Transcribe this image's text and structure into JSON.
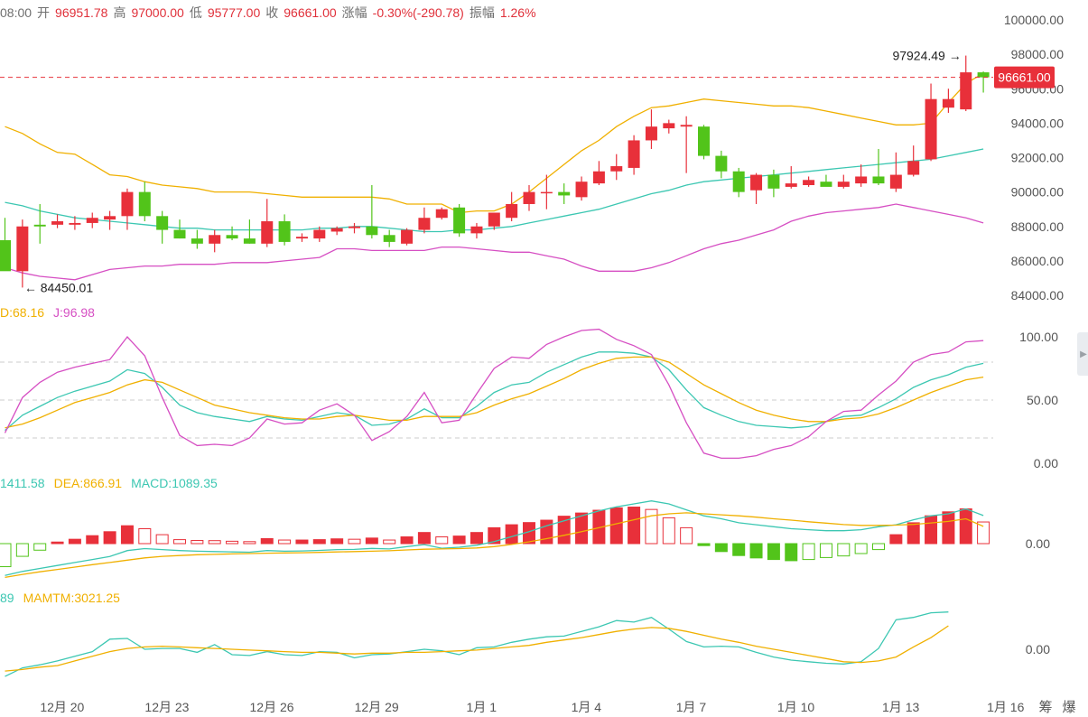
{
  "header": {
    "time": "08:00",
    "open_label": "开",
    "open": "96951.78",
    "high_label": "高",
    "high": "97000.00",
    "low_label": "低",
    "low": "95777.00",
    "close_label": "收",
    "close": "96661.00",
    "change_label": "涨幅",
    "change": "-0.30%(-290.78)",
    "amp_label": "振幅",
    "amp": "1.26%"
  },
  "colors": {
    "up": "#e8303a",
    "down": "#52c41a",
    "ma_yellow": "#f0b000",
    "ma_teal": "#3cc7b2",
    "ma_magenta": "#d64fc3",
    "price_tag": "#e8303a",
    "grid_dash": "#cccccc"
  },
  "annotations": {
    "max_label": "97924.49",
    "min_label": "84450.01",
    "current_price": "96661.00"
  },
  "kdj_labels": {
    "d": "D:68.16",
    "j": "J:96.98"
  },
  "macd_labels": {
    "dif": "1411.58",
    "dea": "DEA:866.91",
    "macd": "MACD:1089.35"
  },
  "mtm_labels": {
    "mtm": "89",
    "mamtm": "MAMTM:3021.25"
  },
  "right_tools": {
    "a": "筹",
    "b": "爆"
  },
  "chart_data": [
    {
      "type": "candlestick",
      "y_ticks": [
        "100000.00",
        "98000.00",
        "96000.00",
        "94000.00",
        "92000.00",
        "90000.00",
        "88000.00",
        "86000.00",
        "84000.00"
      ],
      "ylim": [
        84000,
        100000
      ],
      "x_ticks": [
        "12月 20",
        "12月 23",
        "12月 26",
        "12月 29",
        "1月 1",
        "1月 4",
        "1月 7",
        "1月 10",
        "1月 13",
        "1月 16"
      ],
      "x_tick_index": [
        1,
        7,
        13,
        19,
        25,
        31,
        37,
        43,
        49,
        55
      ],
      "candles": [
        {
          "o": 87200,
          "h": 88500,
          "l": 85500,
          "c": 85400
        },
        {
          "o": 85400,
          "h": 88400,
          "l": 84450.01,
          "c": 88000
        },
        {
          "o": 88100,
          "h": 89300,
          "l": 87000,
          "c": 88000
        },
        {
          "o": 88100,
          "h": 88700,
          "l": 87900,
          "c": 88300
        },
        {
          "o": 88100,
          "h": 88600,
          "l": 87800,
          "c": 88200
        },
        {
          "o": 88200,
          "h": 88800,
          "l": 87900,
          "c": 88500
        },
        {
          "o": 88400,
          "h": 88900,
          "l": 87800,
          "c": 88600
        },
        {
          "o": 88600,
          "h": 90200,
          "l": 87800,
          "c": 90000
        },
        {
          "o": 90000,
          "h": 90600,
          "l": 88300,
          "c": 88600
        },
        {
          "o": 88600,
          "h": 88900,
          "l": 87000,
          "c": 87800
        },
        {
          "o": 87800,
          "h": 88400,
          "l": 87300,
          "c": 87300
        },
        {
          "o": 87300,
          "h": 87800,
          "l": 86700,
          "c": 87000
        },
        {
          "o": 87000,
          "h": 87800,
          "l": 86500,
          "c": 87500
        },
        {
          "o": 87500,
          "h": 88000,
          "l": 87200,
          "c": 87300
        },
        {
          "o": 87300,
          "h": 88400,
          "l": 87000,
          "c": 87000
        },
        {
          "o": 87000,
          "h": 89600,
          "l": 86800,
          "c": 88300
        },
        {
          "o": 88300,
          "h": 88700,
          "l": 86900,
          "c": 87100
        },
        {
          "o": 87300,
          "h": 87600,
          "l": 87100,
          "c": 87400
        },
        {
          "o": 87300,
          "h": 88000,
          "l": 87100,
          "c": 87800
        },
        {
          "o": 87700,
          "h": 88000,
          "l": 87500,
          "c": 87900
        },
        {
          "o": 87900,
          "h": 88200,
          "l": 87600,
          "c": 88000
        },
        {
          "o": 88000,
          "h": 90400,
          "l": 87300,
          "c": 87500
        },
        {
          "o": 87500,
          "h": 87800,
          "l": 86800,
          "c": 87100
        },
        {
          "o": 87000,
          "h": 87900,
          "l": 86900,
          "c": 87800
        },
        {
          "o": 87800,
          "h": 89100,
          "l": 87600,
          "c": 88500
        },
        {
          "o": 88500,
          "h": 89100,
          "l": 88400,
          "c": 89000
        },
        {
          "o": 89100,
          "h": 89300,
          "l": 87400,
          "c": 87600
        },
        {
          "o": 87600,
          "h": 88200,
          "l": 87300,
          "c": 88000
        },
        {
          "o": 88000,
          "h": 88800,
          "l": 87800,
          "c": 88800
        },
        {
          "o": 88500,
          "h": 90000,
          "l": 88300,
          "c": 89300
        },
        {
          "o": 89300,
          "h": 90400,
          "l": 88900,
          "c": 90000
        },
        {
          "o": 90000,
          "h": 91000,
          "l": 89000,
          "c": 90000
        },
        {
          "o": 90000,
          "h": 90500,
          "l": 89300,
          "c": 89800
        },
        {
          "o": 89700,
          "h": 90900,
          "l": 89500,
          "c": 90600
        },
        {
          "o": 90500,
          "h": 91800,
          "l": 90400,
          "c": 91200
        },
        {
          "o": 91200,
          "h": 92200,
          "l": 90700,
          "c": 91500
        },
        {
          "o": 91400,
          "h": 93300,
          "l": 91000,
          "c": 93000
        },
        {
          "o": 93000,
          "h": 94800,
          "l": 92500,
          "c": 93800
        },
        {
          "o": 93700,
          "h": 94200,
          "l": 93400,
          "c": 94000
        },
        {
          "o": 93800,
          "h": 94400,
          "l": 91100,
          "c": 93900
        },
        {
          "o": 93800,
          "h": 93900,
          "l": 91900,
          "c": 92100
        },
        {
          "o": 92100,
          "h": 92400,
          "l": 90800,
          "c": 91200
        },
        {
          "o": 91200,
          "h": 91400,
          "l": 89700,
          "c": 90000
        },
        {
          "o": 90100,
          "h": 91100,
          "l": 89300,
          "c": 91000
        },
        {
          "o": 91000,
          "h": 91300,
          "l": 89700,
          "c": 90200
        },
        {
          "o": 90300,
          "h": 91500,
          "l": 90200,
          "c": 90500
        },
        {
          "o": 90400,
          "h": 90900,
          "l": 90300,
          "c": 90700
        },
        {
          "o": 90600,
          "h": 91000,
          "l": 90400,
          "c": 90300
        },
        {
          "o": 90300,
          "h": 91000,
          "l": 90200,
          "c": 90600
        },
        {
          "o": 90500,
          "h": 91600,
          "l": 90300,
          "c": 90900
        },
        {
          "o": 90900,
          "h": 92500,
          "l": 90400,
          "c": 90500
        },
        {
          "o": 90200,
          "h": 92300,
          "l": 90000,
          "c": 91000
        },
        {
          "o": 91000,
          "h": 92700,
          "l": 90900,
          "c": 91800
        },
        {
          "o": 91900,
          "h": 96300,
          "l": 91800,
          "c": 95400
        },
        {
          "o": 94900,
          "h": 96000,
          "l": 94600,
          "c": 95400
        },
        {
          "o": 94800,
          "h": 97924.49,
          "l": 94700,
          "c": 96951.78
        },
        {
          "o": 96951.78,
          "h": 97000,
          "l": 95777,
          "c": 96661
        }
      ],
      "boll": {
        "upper": [
          93800,
          93400,
          92800,
          92300,
          92200,
          91600,
          91000,
          90900,
          90600,
          90400,
          90300,
          90200,
          90000,
          90000,
          90000,
          89900,
          89800,
          89700,
          89700,
          89700,
          89700,
          89700,
          89600,
          89300,
          89300,
          89300,
          88800,
          88900,
          88900,
          89300,
          90000,
          90800,
          91600,
          92400,
          93000,
          93800,
          94400,
          94900,
          95000,
          95200,
          95400,
          95300,
          95200,
          95100,
          95000,
          95000,
          94900,
          94700,
          94500,
          94300,
          94100,
          93900,
          93900,
          94000,
          95200,
          96300,
          96900
        ],
        "middle": [
          89400,
          89200,
          88900,
          88700,
          88500,
          88400,
          88300,
          88200,
          88100,
          88000,
          87900,
          87900,
          87800,
          87800,
          87800,
          87800,
          87800,
          87800,
          87900,
          87900,
          88000,
          88000,
          87900,
          87800,
          87700,
          87700,
          87800,
          87800,
          87900,
          88000,
          88200,
          88400,
          88600,
          88800,
          89000,
          89300,
          89600,
          89900,
          90100,
          90400,
          90600,
          90700,
          90800,
          90900,
          91000,
          91100,
          91200,
          91300,
          91400,
          91500,
          91600,
          91700,
          91800,
          91900,
          92100,
          92300,
          92500
        ],
        "lower": [
          85600,
          85300,
          85100,
          85000,
          84900,
          85200,
          85500,
          85600,
          85700,
          85700,
          85800,
          85800,
          85800,
          85900,
          85900,
          85900,
          86000,
          86100,
          86200,
          86700,
          86700,
          86600,
          86600,
          86600,
          86600,
          86800,
          86800,
          86700,
          86600,
          86500,
          86500,
          86300,
          86100,
          85700,
          85400,
          85400,
          85400,
          85600,
          85900,
          86300,
          86700,
          87000,
          87200,
          87500,
          87800,
          88300,
          88600,
          88800,
          88900,
          89000,
          89100,
          89300,
          89100,
          88900,
          88700,
          88500,
          88200
        ]
      }
    },
    {
      "type": "line",
      "name_hint": "KDJ",
      "y_ticks": [
        "100.00",
        "50.00",
        "0.00"
      ],
      "ylim": [
        0,
        100
      ],
      "dashed_levels": [
        80,
        50,
        20
      ],
      "series": [
        {
          "name": "K",
          "values": [
            26,
            38,
            45,
            52,
            57,
            61,
            65,
            74,
            71,
            60,
            46,
            40,
            37,
            35,
            33,
            37,
            35,
            34,
            37,
            40,
            38,
            30,
            31,
            35,
            43,
            36,
            36,
            45,
            56,
            62,
            64,
            72,
            78,
            84,
            88,
            88,
            87,
            84,
            74,
            58,
            44,
            38,
            33,
            30,
            29,
            28,
            29,
            33,
            37,
            38,
            44,
            51,
            60,
            66,
            70,
            76,
            79
          ]
        },
        {
          "name": "D",
          "values": [
            28,
            31,
            36,
            42,
            48,
            52,
            56,
            62,
            66,
            64,
            58,
            52,
            46,
            43,
            40,
            38,
            36,
            35,
            35,
            37,
            38,
            36,
            34,
            34,
            37,
            37,
            37,
            40,
            46,
            51,
            55,
            61,
            67,
            74,
            79,
            83,
            84,
            84,
            80,
            71,
            62,
            55,
            48,
            42,
            38,
            35,
            33,
            33,
            35,
            36,
            39,
            44,
            50,
            56,
            61,
            66,
            68.16
          ]
        },
        {
          "name": "J",
          "values": [
            24,
            52,
            64,
            72,
            76,
            79,
            82,
            100,
            85,
            52,
            22,
            14,
            15,
            14,
            20,
            35,
            31,
            32,
            42,
            47,
            38,
            18,
            25,
            37,
            56,
            32,
            34,
            55,
            75,
            84,
            83,
            94,
            100,
            105,
            106,
            98,
            93,
            86,
            62,
            32,
            8,
            4,
            4,
            6,
            11,
            14,
            21,
            33,
            41,
            42,
            54,
            65,
            80,
            86,
            88,
            96,
            96.98
          ]
        }
      ]
    },
    {
      "type": "bar",
      "name_hint": "MACD",
      "y_ticks": [
        "0.00"
      ],
      "series": [
        {
          "name": "DIF",
          "values": [
            -1600,
            -1400,
            -1250,
            -1100,
            -950,
            -800,
            -650,
            -350,
            -250,
            -300,
            -350,
            -380,
            -400,
            -420,
            -430,
            -350,
            -380,
            -370,
            -340,
            -300,
            -290,
            -240,
            -270,
            -150,
            -50,
            -230,
            -180,
            -80,
            100,
            350,
            600,
            900,
            1150,
            1400,
            1650,
            1850,
            2000,
            2150,
            2000,
            1700,
            1400,
            1250,
            1050,
            950,
            850,
            750,
            700,
            650,
            650,
            700,
            850,
            950,
            1200,
            1400,
            1500,
            1750,
            1411.58
          ]
        },
        {
          "name": "DEA",
          "values": [
            -1700,
            -1550,
            -1420,
            -1300,
            -1180,
            -1060,
            -950,
            -830,
            -720,
            -640,
            -600,
            -560,
            -540,
            -520,
            -500,
            -480,
            -470,
            -460,
            -440,
            -420,
            -400,
            -380,
            -360,
            -320,
            -280,
            -270,
            -250,
            -220,
            -150,
            -40,
            90,
            250,
            420,
            600,
            800,
            1000,
            1200,
            1400,
            1500,
            1550,
            1500,
            1450,
            1400,
            1330,
            1250,
            1180,
            1100,
            1030,
            960,
            920,
            920,
            930,
            970,
            1040,
            1120,
            1250,
            866.91
          ]
        },
        {
          "name": "MACD",
          "values": [
            -1160,
            -640,
            -330,
            80,
            220,
            400,
            600,
            900,
            750,
            450,
            200,
            160,
            150,
            120,
            100,
            250,
            180,
            180,
            200,
            240,
            220,
            280,
            180,
            340,
            560,
            340,
            380,
            560,
            800,
            950,
            1060,
            1180,
            1380,
            1540,
            1680,
            1800,
            1840,
            1720,
            1300,
            800,
            -100,
            -400,
            -600,
            -720,
            -800,
            -860,
            -800,
            -700,
            -620,
            -500,
            -300,
            450,
            1050,
            1400,
            1600,
            1750,
            1089.35
          ]
        }
      ]
    },
    {
      "type": "line",
      "name_hint": "MTM",
      "y_ticks": [
        "0.00"
      ],
      "series": [
        {
          "name": "MTM",
          "values": [
            -3500,
            -2400,
            -2000,
            -1500,
            -900,
            -300,
            1300,
            1400,
            0,
            100,
            100,
            -400,
            600,
            -700,
            -800,
            -300,
            -700,
            -800,
            -300,
            -400,
            -1100,
            -700,
            -600,
            -300,
            0,
            -200,
            -700,
            200,
            300,
            900,
            1300,
            1600,
            1700,
            2300,
            2900,
            3700,
            3500,
            4100,
            2600,
            1000,
            300,
            400,
            300,
            -400,
            -1000,
            -1400,
            -1600,
            -1800,
            -1900,
            -1600,
            100,
            3800,
            4100,
            4700,
            4800
          ]
        },
        {
          "name": "MAMTM",
          "values": [
            -2800,
            -2600,
            -2300,
            -2100,
            -1500,
            -900,
            -300,
            100,
            300,
            400,
            300,
            200,
            100,
            0,
            -100,
            -200,
            -300,
            -400,
            -400,
            -500,
            -600,
            -500,
            -500,
            -400,
            -400,
            -300,
            -200,
            -100,
            100,
            300,
            500,
            900,
            1200,
            1500,
            1900,
            2300,
            2600,
            2800,
            2700,
            2300,
            1800,
            1300,
            900,
            400,
            0,
            -400,
            -800,
            -1200,
            -1600,
            -1700,
            -1500,
            -1000,
            300,
            1500,
            3021.25
          ]
        }
      ]
    }
  ]
}
